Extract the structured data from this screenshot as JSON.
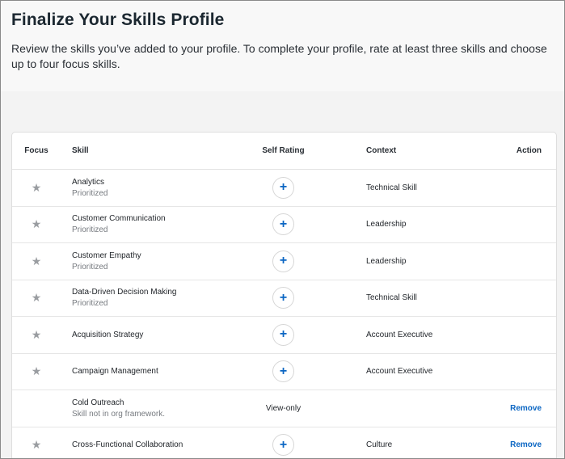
{
  "header": {
    "title": "Finalize Your Skills Profile",
    "description": "Review the skills you’ve added to your profile. To complete your profile, rate at least three skills and choose up to four focus skills."
  },
  "table": {
    "columns": {
      "focus": "Focus",
      "skill": "Skill",
      "rating": "Self Rating",
      "context": "Context",
      "action": "Action"
    },
    "rows": [
      {
        "name": "Analytics",
        "sub": "Prioritized",
        "rating": "+",
        "context": "Technical Skill",
        "action": ""
      },
      {
        "name": "Customer Communication",
        "sub": "Prioritized",
        "rating": "+",
        "context": "Leadership",
        "action": ""
      },
      {
        "name": "Customer Empathy",
        "sub": "Prioritized",
        "rating": "+",
        "context": "Leadership",
        "action": ""
      },
      {
        "name": "Data-Driven Decision Making",
        "sub": "Prioritized",
        "rating": "+",
        "context": "Technical Skill",
        "action": ""
      },
      {
        "name": "Acquisition Strategy",
        "sub": "",
        "rating": "+",
        "context": "Account Executive",
        "action": ""
      },
      {
        "name": "Campaign Management",
        "sub": "",
        "rating": "+",
        "context": "Account Executive",
        "action": ""
      },
      {
        "name": "Cold Outreach",
        "sub": "Skill not in org framework.",
        "rating": "View-only",
        "context": "",
        "action": "Remove"
      },
      {
        "name": "Cross-Functional Collaboration",
        "sub": "",
        "rating": "+",
        "context": "Culture",
        "action": "Remove"
      }
    ]
  },
  "icons": {
    "star": "★",
    "star_name": "star-icon",
    "plus_name": "plus-icon"
  },
  "colors": {
    "accent": "#0b66c3",
    "star": "#9a9da1"
  }
}
